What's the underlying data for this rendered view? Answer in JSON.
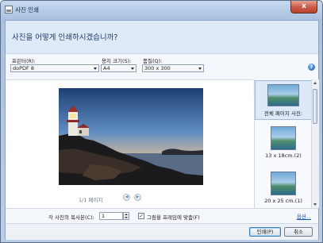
{
  "window": {
    "title": "사진 인쇄",
    "close_label": "x"
  },
  "header": {
    "heading": "사진을 어떻게 인쇄하시겠습니까?"
  },
  "controls": {
    "printer_label": "프린터(R):",
    "printer_value": "doPDF 8",
    "paper_size_label": "용지 크기(S):",
    "paper_size_value": "A4",
    "quality_label": "품질(Q):",
    "quality_value": "300 x 300",
    "help_label": "?"
  },
  "preview": {
    "page_info": "1/1 페이지",
    "prev_label": "◀",
    "next_label": "▶"
  },
  "layouts": [
    {
      "label": "전체 페이지 사진:",
      "selected": true
    },
    {
      "label": "13 x 18cm.(2)",
      "selected": false
    },
    {
      "label": "20 x 25 cm.(1)",
      "selected": false
    }
  ],
  "options": {
    "copies_label": "각 사진의 복사본(C):",
    "copies_value": "1",
    "fit_label": "그림을 프레임에 맞춤(F)",
    "fit_checked": true,
    "fit_check_glyph": "✓",
    "options_link": "옵션..."
  },
  "footer": {
    "print_button": "인쇄(P)",
    "cancel_button": "취소"
  },
  "colors": {
    "accent": "#1e3b66",
    "link": "#1a56b3",
    "close": "#c75a45"
  }
}
